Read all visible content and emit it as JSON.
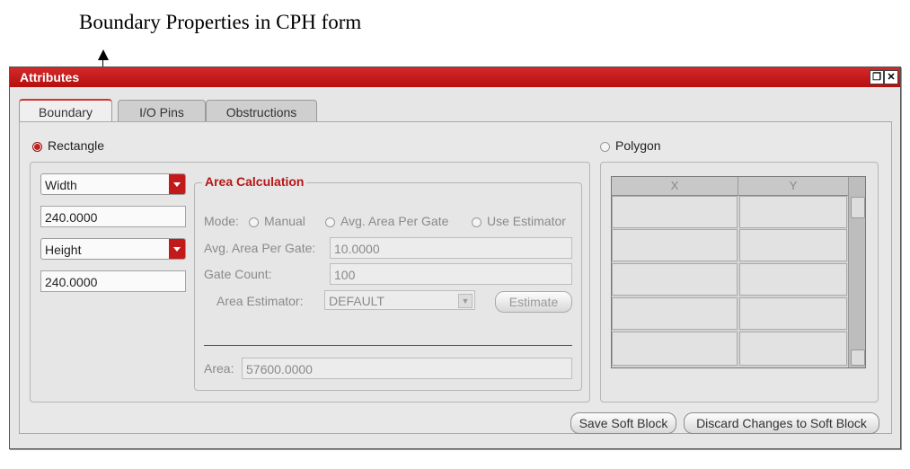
{
  "caption": "Boundary Properties in CPH form",
  "window": {
    "title": "Attributes"
  },
  "tabs": [
    "Boundary",
    "I/O Pins",
    "Obstructions"
  ],
  "rectangle": {
    "label": "Rectangle",
    "selected": true
  },
  "polygon": {
    "label": "Polygon",
    "selected": false
  },
  "dimension1": {
    "select": "Width",
    "value": "240.0000"
  },
  "dimension2": {
    "select": "Height",
    "value": "240.0000"
  },
  "area_calc": {
    "title": "Area Calculation",
    "mode_label": "Mode:",
    "modes": [
      "Manual",
      "Avg. Area Per Gate",
      "Use Estimator"
    ],
    "avg_label": "Avg. Area Per Gate:",
    "avg_value": "10.0000",
    "gate_label": "Gate Count:",
    "gate_value": "100",
    "estimator_label": "Area Estimator:",
    "estimator_value": "DEFAULT",
    "estimate_button": "Estimate",
    "area_label": "Area:",
    "area_value": "57600.0000"
  },
  "polygon_table": {
    "columns": [
      "X",
      "Y"
    ]
  },
  "buttons": {
    "save": "Save Soft Block",
    "discard": "Discard Changes to Soft Block"
  },
  "colors": {
    "accent": "#c21a1a",
    "title_bar": "#c41c1c"
  }
}
